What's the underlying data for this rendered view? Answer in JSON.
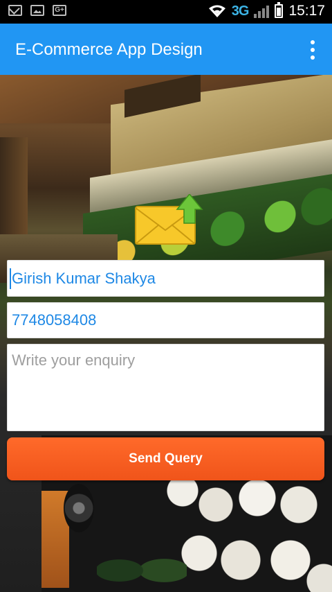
{
  "status_bar": {
    "network": "3G",
    "time": "15:17",
    "icons": [
      "gmail-icon",
      "gallery-icon",
      "google-plus-icon",
      "wifi-icon",
      "signal-icon",
      "battery-icon"
    ]
  },
  "app_bar": {
    "title": "E-Commerce App Design",
    "menu_icon": "overflow-menu-icon",
    "color": "#2196f3"
  },
  "form": {
    "name_value": "Girish Kumar Shakya",
    "phone_value": "7748058408",
    "enquiry_placeholder": "Write your enquiry",
    "submit_label": "Send Query",
    "accent": "#f0541a"
  }
}
